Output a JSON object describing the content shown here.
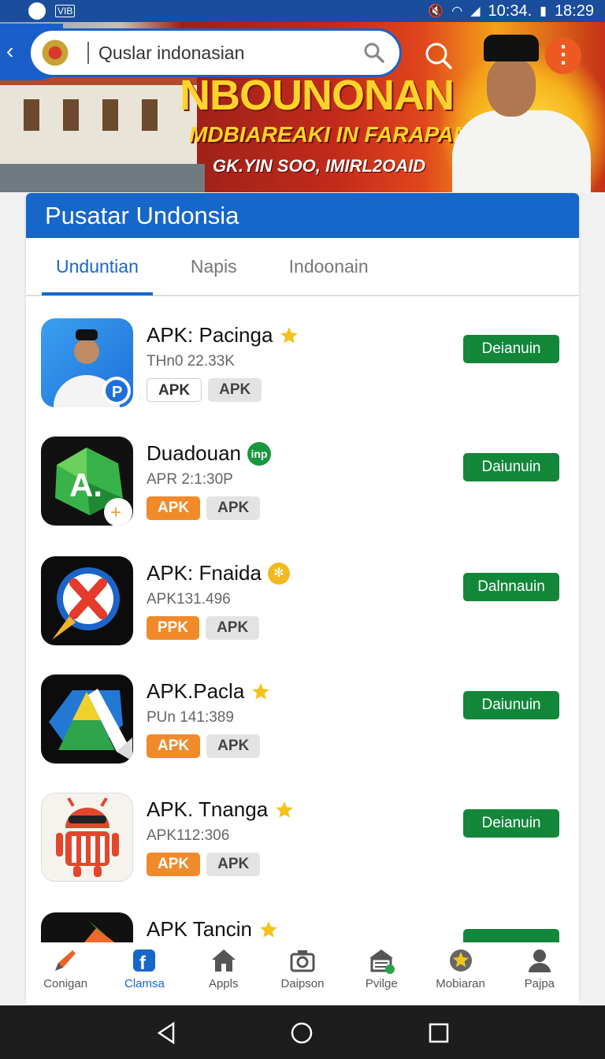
{
  "status_bar": {
    "notification": "VIB",
    "time_left": "10:34.",
    "time_right": "18:29"
  },
  "hero": {
    "headline": "NBOUNONAN",
    "subline": "MDBIAREAKI IN FARAPAM",
    "tagline": "GK.YIN SOO, IMIRL2OAID"
  },
  "search": {
    "value": "Quslar indonasian"
  },
  "card": {
    "title": "Pusatar Undonsia",
    "tabs": [
      {
        "label": "Unduntian",
        "active": true
      },
      {
        "label": "Napis",
        "active": false
      },
      {
        "label": "Indoonain",
        "active": false
      }
    ]
  },
  "apps": [
    {
      "name": "APK: Pacinga",
      "meta": "THn0 22.33K",
      "tags": [
        "APK",
        "APK"
      ],
      "tag_styles": [
        "white",
        "grey"
      ],
      "badge": "star",
      "button": "Deianuin",
      "icon": "person-p-icon"
    },
    {
      "name": "Duadouan",
      "meta": "APR 2:1:30P",
      "tags": [
        "APK",
        "APK"
      ],
      "tag_styles": [
        "orange",
        "grey"
      ],
      "badge": "green",
      "badge_text": "inp",
      "button": "Daiunuin",
      "icon": "green-gem-a-icon"
    },
    {
      "name": "APK: Fnaida",
      "meta": "APK131.496",
      "tags": [
        "PPK",
        "APK"
      ],
      "tag_styles": [
        "orange",
        "grey"
      ],
      "badge": "gold",
      "button": "Dalnnauin",
      "icon": "red-x-circle-icon"
    },
    {
      "name": "APK.Pacla",
      "meta": "PUn 141:389",
      "tags": [
        "APK",
        "APK"
      ],
      "tag_styles": [
        "orange",
        "grey"
      ],
      "badge": "star",
      "button": "Daiunuin",
      "icon": "triangle-a-icon"
    },
    {
      "name": "APK. Tnanga",
      "meta": "APK112:306",
      "tags": [
        "APK",
        "APK"
      ],
      "tag_styles": [
        "orange",
        "grey"
      ],
      "badge": "star",
      "button": "Deianuin",
      "icon": "android-robot-icon"
    },
    {
      "name": "APK Tancin",
      "meta": "",
      "tags": [],
      "tag_styles": [],
      "badge": "star",
      "button": "",
      "icon": "orange-arrow-icon"
    }
  ],
  "bottom_nav": [
    {
      "label": "Conigan",
      "icon": "pencil-icon",
      "active": false
    },
    {
      "label": "Clamsa",
      "icon": "facebook-icon",
      "active": true
    },
    {
      "label": "Appls",
      "icon": "home-icon",
      "active": false
    },
    {
      "label": "Daipson",
      "icon": "camera-icon",
      "active": false
    },
    {
      "label": "Pvilge",
      "icon": "store-icon",
      "active": false
    },
    {
      "label": "Mobiaran",
      "icon": "star-badge-icon",
      "active": false
    },
    {
      "label": "Pajpa",
      "icon": "profile-icon",
      "active": false
    }
  ],
  "colors": {
    "primary": "#1766c9",
    "download": "#12873a",
    "tag_orange": "#f18a2a",
    "menu_orange": "#ec5a22"
  }
}
